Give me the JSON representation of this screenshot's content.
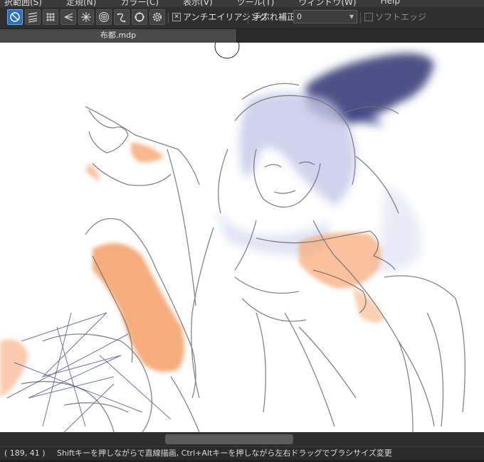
{
  "menubar": {
    "items": [
      "択範囲(S)",
      "定規(N)",
      "カラー(C)",
      "表示(V)",
      "ツール(T)",
      "ウィンドウ(W)",
      "Help"
    ]
  },
  "toolbar": {
    "tools": [
      "circle-slash-icon",
      "hatch-lines-icon",
      "grid-icon",
      "perspective-icon",
      "radial-lines-icon",
      "concentric-icon",
      "curve-icon",
      "circle-ruler-icon",
      "gear-icon"
    ],
    "antialias_label": "アンチエイリアシング",
    "antialias_checked": true,
    "stabilizer_label": "手ぶれ補正",
    "stabilizer_value": "0",
    "soft_edge_label": "ソフトエッジ",
    "soft_edge_checked": false
  },
  "document": {
    "tab_title": "布都.mdp"
  },
  "statusbar": {
    "coords": "( 189, 41 )",
    "message": "Shiftキーを押しながらで直線描画, Ctrl+Altキーを押しながら左右ドラッグでブラシサイズ変更"
  },
  "colors": {
    "accent": "#2d6fb8",
    "skin": "#f4a06a",
    "hat": "#2a2f6a",
    "hair": "#b8bde0",
    "sketch": "#6a6a6a"
  }
}
